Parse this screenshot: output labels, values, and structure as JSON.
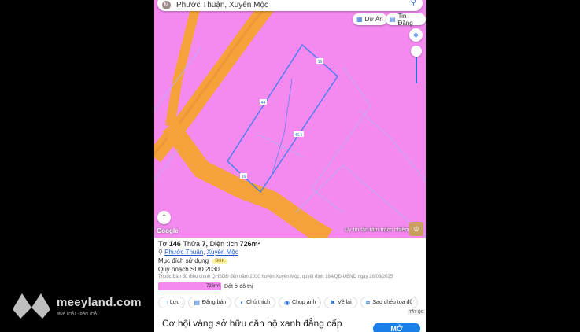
{
  "search": {
    "avatar_letter": "M",
    "text": "Phước Thuận, Xuyên Mộc"
  },
  "chips": {
    "project": "Dự Án",
    "listings": "Tin Đăng"
  },
  "map": {
    "plot_labels": [
      "16",
      "44",
      "46,1",
      "16"
    ],
    "google": "Google",
    "trust_text": "Uy tín tận tâm trách nhiệm"
  },
  "info": {
    "title_prefix": "Tờ",
    "sheet": "146",
    "parcel_label": "Thửa",
    "parcel": "7",
    "area_label": "Diện tích",
    "area": "726m²",
    "ward": "Phước Thuận",
    "district": "Xuyên Mộc",
    "usage_label": "Mục đích sử dụng",
    "usage_code": "BHK",
    "plan_label": "Quy hoạch SDĐ 2030",
    "source_note": "Thuộc Bản đồ điều chỉnh QHSDĐ đến năm 2030 huyện Xuyên Mộc, quyết định 184/QĐ-UBND ngày 28/03/2025",
    "land_area": "726m²",
    "land_type": "Đất ở đô thị"
  },
  "actions": [
    "Lưu",
    "Đăng bán",
    "Chú thích",
    "Chụp ảnh",
    "Vẽ lại",
    "Sao chép tọa độ"
  ],
  "ad": {
    "tag": "TẮT QC",
    "text": "Cơ hội vàng sở hữu căn hộ xanh đẳng cấp",
    "button": "MỞ"
  },
  "watermark": {
    "brand": "meeyland.com",
    "tagline": "MUA THẬT - BÁN THẬT"
  },
  "colors": {
    "map_pink": "#f48af0",
    "road_orange": "#f6a23a",
    "accent": "#2a6fd6"
  }
}
